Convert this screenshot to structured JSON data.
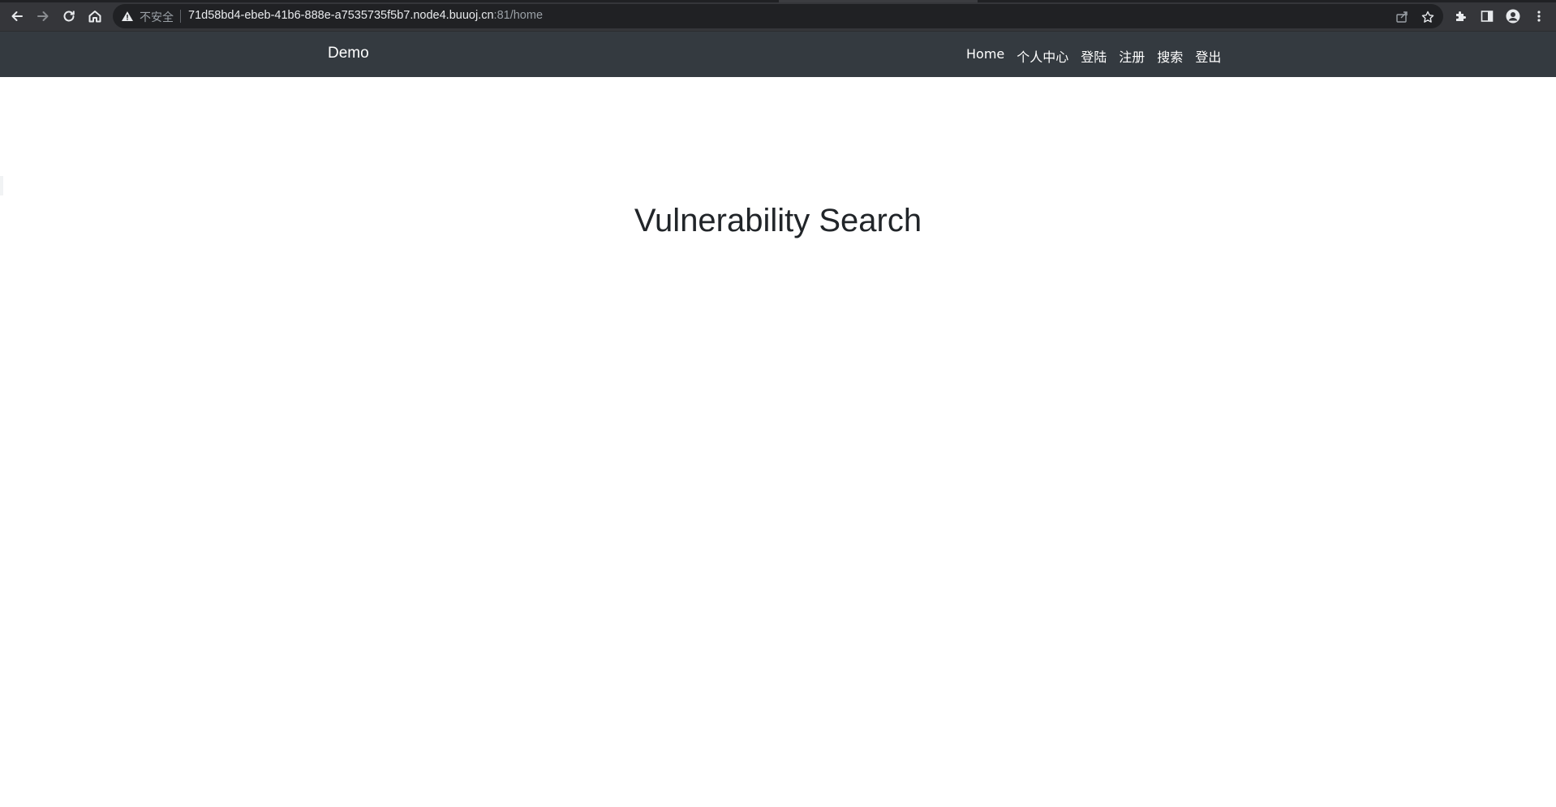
{
  "browser": {
    "security_label": "不安全",
    "url_host": "71d58bd4-ebeb-41b6-888e-a7535735f5b7.node4.buuoj.cn",
    "url_rest": ":81/home",
    "icons": [
      "back-icon",
      "forward-icon",
      "reload-icon",
      "home-icon",
      "warning-icon",
      "share-icon",
      "star-icon",
      "extensions-icon",
      "side-panel-icon",
      "profile-icon",
      "menu-icon"
    ],
    "colors": {
      "chrome_bg": "#35363a",
      "omnibox_bg": "#202124",
      "url_text": "#e8eaed",
      "url_dim": "#9aa0a6"
    }
  },
  "navbar": {
    "brand": "Demo",
    "items": [
      {
        "label": "Home"
      },
      {
        "label": "个人中心"
      },
      {
        "label": "登陆"
      },
      {
        "label": "注册"
      },
      {
        "label": "搜索"
      },
      {
        "label": "登出"
      }
    ],
    "colors": {
      "bg": "#343a40",
      "text": "#ffffff"
    }
  },
  "main": {
    "title": "Vulnerability Search",
    "colors": {
      "title": "#212529"
    }
  }
}
